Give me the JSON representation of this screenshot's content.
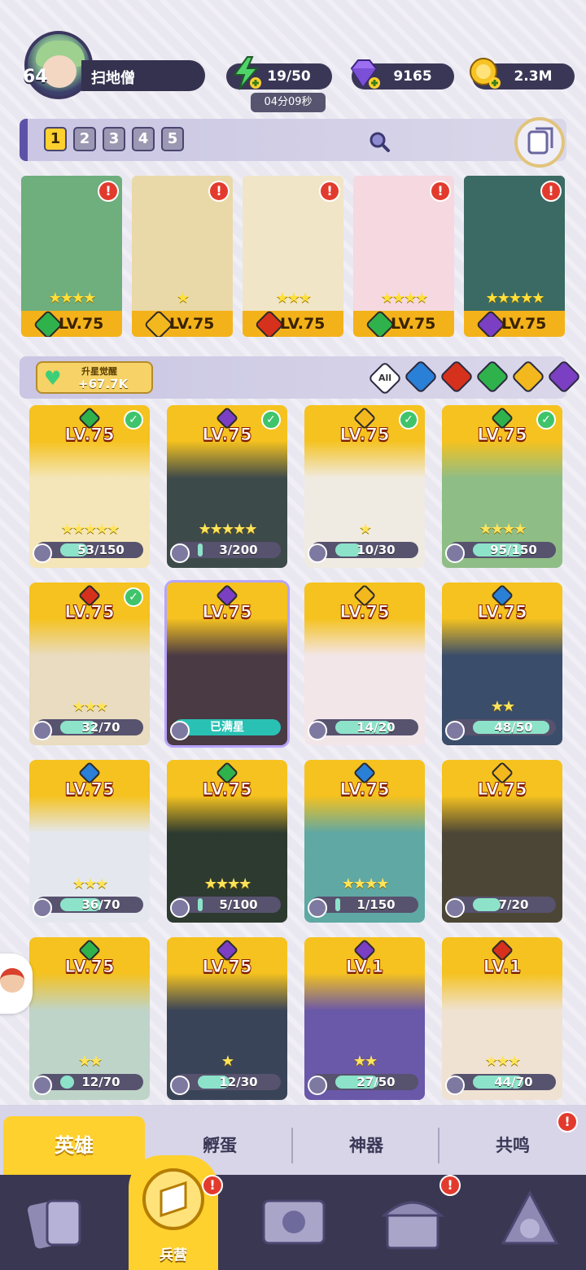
{
  "player": {
    "level": "64",
    "name": "扫地僧"
  },
  "resources": {
    "energy": "19/50",
    "energy_timer": "04分09秒",
    "gems": "9165",
    "gold": "2.3M"
  },
  "teams": {
    "tabs": [
      "1",
      "2",
      "3",
      "4",
      "5"
    ],
    "active": "1"
  },
  "deck": [
    {
      "level": "LV.75",
      "element": "nature",
      "stars": "★★★★",
      "alert": "!"
    },
    {
      "level": "LV.75",
      "element": "light",
      "stars": "★",
      "alert": "!"
    },
    {
      "level": "LV.75",
      "element": "fire",
      "stars": "★★★",
      "alert": "!"
    },
    {
      "level": "LV.75",
      "element": "nature",
      "stars": "★★★★",
      "alert": "!"
    },
    {
      "level": "LV.75",
      "element": "dark",
      "stars": "★★★★★",
      "alert": "!"
    }
  ],
  "awaken": {
    "label": "升星觉醒",
    "value": "+67.7K"
  },
  "filters": {
    "all": "All",
    "elements": [
      "water",
      "fire",
      "nature",
      "light",
      "dark"
    ]
  },
  "element_colors": {
    "nature": "#2fb24c",
    "light": "#f2b81e",
    "fire": "#d6311c",
    "water": "#2a7fd6",
    "dark": "#7a3fc2"
  },
  "heroes": [
    {
      "level": "LV.75",
      "element": "nature",
      "progress": "53/150",
      "fraction": 0.35,
      "stars": "★★★★★",
      "checked": true
    },
    {
      "level": "LV.75",
      "element": "dark",
      "progress": "3/200",
      "fraction": 0.015,
      "stars": "★★★★★",
      "checked": true
    },
    {
      "level": "LV.75",
      "element": "light",
      "progress": "10/30",
      "fraction": 0.33,
      "stars": "★",
      "checked": true
    },
    {
      "level": "LV.75",
      "element": "nature",
      "progress": "95/150",
      "fraction": 0.63,
      "stars": "★★★★",
      "checked": true
    },
    {
      "level": "LV.75",
      "element": "fire",
      "progress": "32/70",
      "fraction": 0.46,
      "stars": "★★★",
      "checked": true
    },
    {
      "level": "LV.75",
      "element": "dark",
      "progress": "已满星",
      "fraction": 1,
      "stars": "",
      "checked": false,
      "maxed": true
    },
    {
      "level": "LV.75",
      "element": "light",
      "progress": "14/20",
      "fraction": 0.7,
      "stars": "",
      "checked": false
    },
    {
      "level": "LV.75",
      "element": "water",
      "progress": "48/50",
      "fraction": 0.96,
      "stars": "★★",
      "checked": false
    },
    {
      "level": "LV.75",
      "element": "water",
      "progress": "36/70",
      "fraction": 0.51,
      "stars": "★★★",
      "checked": false
    },
    {
      "level": "LV.75",
      "element": "nature",
      "progress": "5/100",
      "fraction": 0.05,
      "stars": "★★★★",
      "checked": false
    },
    {
      "level": "LV.75",
      "element": "water",
      "progress": "1/150",
      "fraction": 0.01,
      "stars": "★★★★",
      "checked": false
    },
    {
      "level": "LV.75",
      "element": "light",
      "progress": "7/20",
      "fraction": 0.35,
      "stars": "",
      "checked": false
    },
    {
      "level": "LV.75",
      "element": "nature",
      "progress": "12/70",
      "fraction": 0.17,
      "stars": "★★",
      "checked": false
    },
    {
      "level": "LV.75",
      "element": "dark",
      "progress": "12/30",
      "fraction": 0.4,
      "stars": "★",
      "checked": false
    },
    {
      "level": "LV.1",
      "element": "dark",
      "progress": "27/50",
      "fraction": 0.54,
      "stars": "★★",
      "checked": false
    },
    {
      "level": "LV.1",
      "element": "fire",
      "progress": "44/70",
      "fraction": 0.63,
      "stars": "★★★",
      "checked": false
    }
  ],
  "subtabs": {
    "heroes": "英雄",
    "hatch": "孵蛋",
    "artifacts": "神器",
    "resonance": "共鸣"
  },
  "bottom_nav": {
    "active_label": "兵营"
  }
}
